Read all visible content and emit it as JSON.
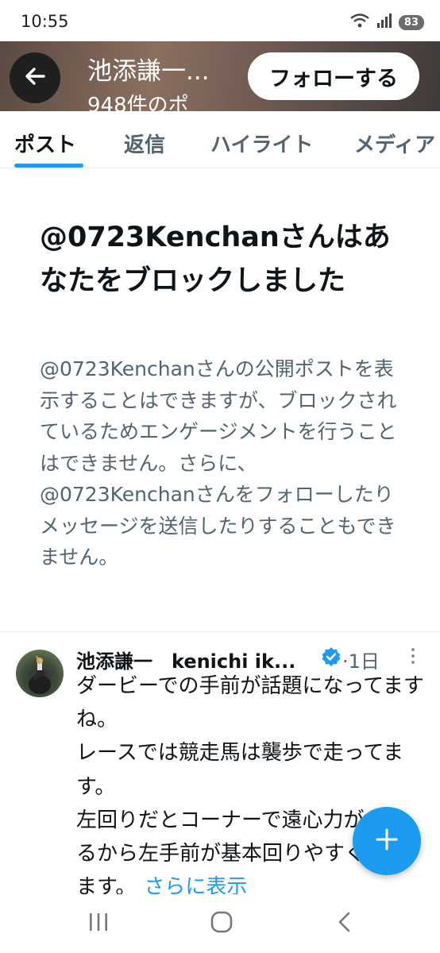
{
  "status_bar": {
    "time": "10:55",
    "battery": "83"
  },
  "header": {
    "name": "池添謙一...",
    "post_count": "948件のポ",
    "follow_label": "フォローする"
  },
  "tabs": [
    {
      "label": "ポスト",
      "active": true
    },
    {
      "label": "返信",
      "active": false
    },
    {
      "label": "ハイライト",
      "active": false
    },
    {
      "label": "メディア",
      "active": false
    }
  ],
  "blocked": {
    "title": "@0723Kenchanさんはあなたをブロックしました",
    "description": "@0723Kenchanさんの公開ポストを表示することはできますが、ブロックされているためエンゲージメントを行うことはできません。さらに、@0723Kenchanさんをフォローしたりメッセージを送信したりすることもできません。"
  },
  "post": {
    "author": "池添謙一　kenichi ik...",
    "time": "·1日",
    "body": "ダービーでの手前が話題になってますね。\nレースでは競走馬は襲歩で走ってます。\n左回りだとコーナーで遠心力がかかるから左手前が基本回りやすくなります。",
    "show_more": "さらに表示"
  },
  "colors": {
    "accent": "#1d9bf0",
    "text": "#0f1419",
    "secondary": "#536471"
  },
  "icons": [
    "back-arrow-icon",
    "verified-badge-icon",
    "more-icon",
    "compose-plus-icon",
    "recent-apps-icon",
    "home-icon",
    "back-icon"
  ]
}
